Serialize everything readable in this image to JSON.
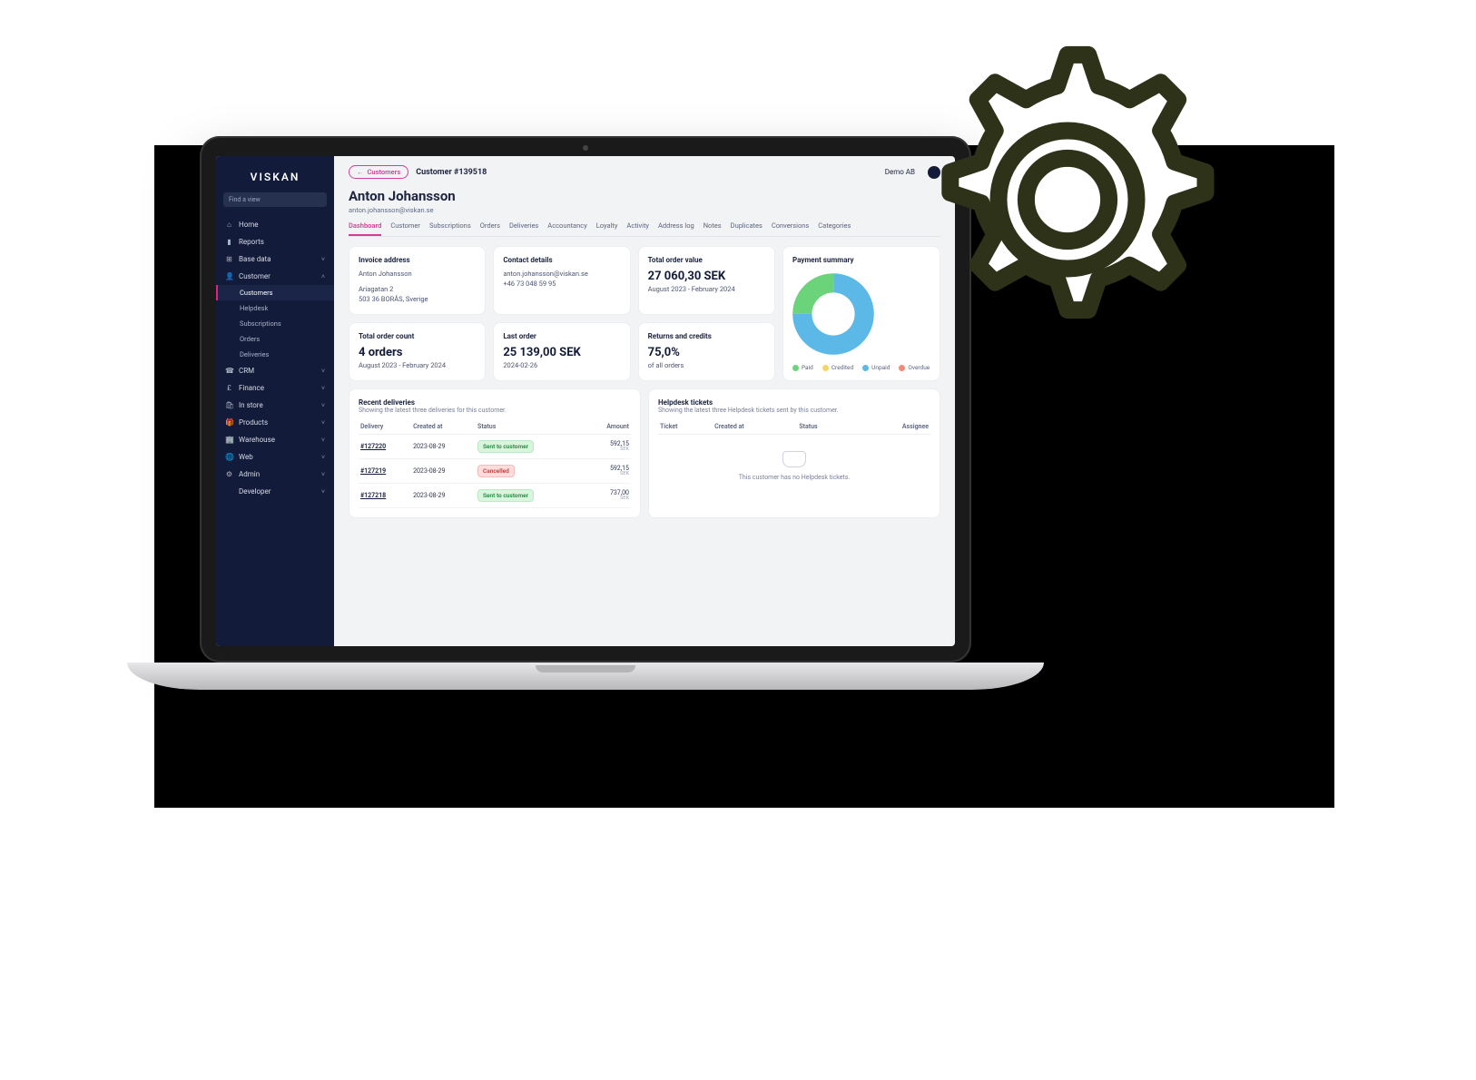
{
  "brand": "VISKAN",
  "find_view": "Find a view",
  "org": "Demo AB",
  "sidebar": {
    "items": [
      {
        "icon": "⌂",
        "label": "Home",
        "expandable": false
      },
      {
        "icon": "▮",
        "label": "Reports",
        "expandable": false
      },
      {
        "icon": "⊞",
        "label": "Base data",
        "expandable": true,
        "open": false
      },
      {
        "icon": "👤",
        "label": "Customer",
        "expandable": true,
        "open": true,
        "children": [
          {
            "label": "Customers",
            "active": true
          },
          {
            "label": "Helpdesk"
          },
          {
            "label": "Subscriptions"
          },
          {
            "label": "Orders"
          },
          {
            "label": "Deliveries"
          }
        ]
      },
      {
        "icon": "☎",
        "label": "CRM",
        "expandable": true
      },
      {
        "icon": "£",
        "label": "Finance",
        "expandable": true
      },
      {
        "icon": "🛍",
        "label": "In store",
        "expandable": true
      },
      {
        "icon": "🎁",
        "label": "Products",
        "expandable": true
      },
      {
        "icon": "🏢",
        "label": "Warehouse",
        "expandable": true
      },
      {
        "icon": "🌐",
        "label": "Web",
        "expandable": true
      },
      {
        "icon": "⚙",
        "label": "Admin",
        "expandable": true
      },
      {
        "icon": "</>",
        "label": "Developer",
        "expandable": true
      }
    ]
  },
  "header": {
    "back_label": "Customers",
    "breadcrumb": "Customer #139518"
  },
  "customer": {
    "name": "Anton Johansson",
    "email": "anton.johansson@viskan.se"
  },
  "tabs": [
    "Dashboard",
    "Customer",
    "Subscriptions",
    "Orders",
    "Deliveries",
    "Accountancy",
    "Loyalty",
    "Activity",
    "Address log",
    "Notes",
    "Duplicates",
    "Conversions",
    "Categories"
  ],
  "active_tab": "Dashboard",
  "cards": {
    "invoice": {
      "title": "Invoice address",
      "name": "Anton Johansson",
      "street": "Ariagatan 2",
      "city": "503 36 BORÅS, Sverige"
    },
    "contact": {
      "title": "Contact details",
      "email": "anton.johansson@viskan.se",
      "phone": "+46 73 048 59 95"
    },
    "total_value": {
      "title": "Total order value",
      "value": "27 060,30 SEK",
      "range": "August 2023 - February 2024"
    },
    "order_count": {
      "title": "Total order count",
      "value": "4 orders",
      "range": "August 2023 - February 2024"
    },
    "last_order": {
      "title": "Last order",
      "value": "25 139,00 SEK",
      "date": "2024-02-26"
    },
    "returns": {
      "title": "Returns and credits",
      "value": "75,0%",
      "sub": "of all orders"
    },
    "payment": {
      "title": "Payment summary",
      "legend": [
        {
          "label": "Paid",
          "color": "#6bd37a"
        },
        {
          "label": "Credited",
          "color": "#f5d565"
        },
        {
          "label": "Unpaid",
          "color": "#5cb8e6"
        },
        {
          "label": "Overdue",
          "color": "#f08a7a"
        }
      ]
    }
  },
  "deliveries": {
    "title": "Recent deliveries",
    "sub": "Showing the latest three deliveries for this customer.",
    "columns": [
      "Delivery",
      "Created at",
      "Status",
      "Amount"
    ],
    "rows": [
      {
        "id": "#127220",
        "date": "2023-08-29",
        "status": "Sent to customer",
        "status_type": "green",
        "amount": "592,15",
        "currency": "SEK"
      },
      {
        "id": "#127219",
        "date": "2023-08-29",
        "status": "Cancelled",
        "status_type": "red",
        "amount": "592,15",
        "currency": "SEK"
      },
      {
        "id": "#127218",
        "date": "2023-08-29",
        "status": "Sent to customer",
        "status_type": "green",
        "amount": "737,00",
        "currency": "SEK"
      }
    ]
  },
  "tickets": {
    "title": "Helpdesk tickets",
    "sub": "Showing the latest three Helpdesk tickets sent by this customer.",
    "columns": [
      "Ticket",
      "Created at",
      "Status",
      "Assignee"
    ],
    "empty": "This customer has no Helpdesk tickets."
  },
  "chart_data": {
    "type": "pie",
    "title": "Payment summary",
    "series": [
      {
        "name": "Unpaid",
        "value": 75,
        "color": "#5cb8e6"
      },
      {
        "name": "Paid",
        "value": 25,
        "color": "#6bd37a"
      }
    ]
  }
}
